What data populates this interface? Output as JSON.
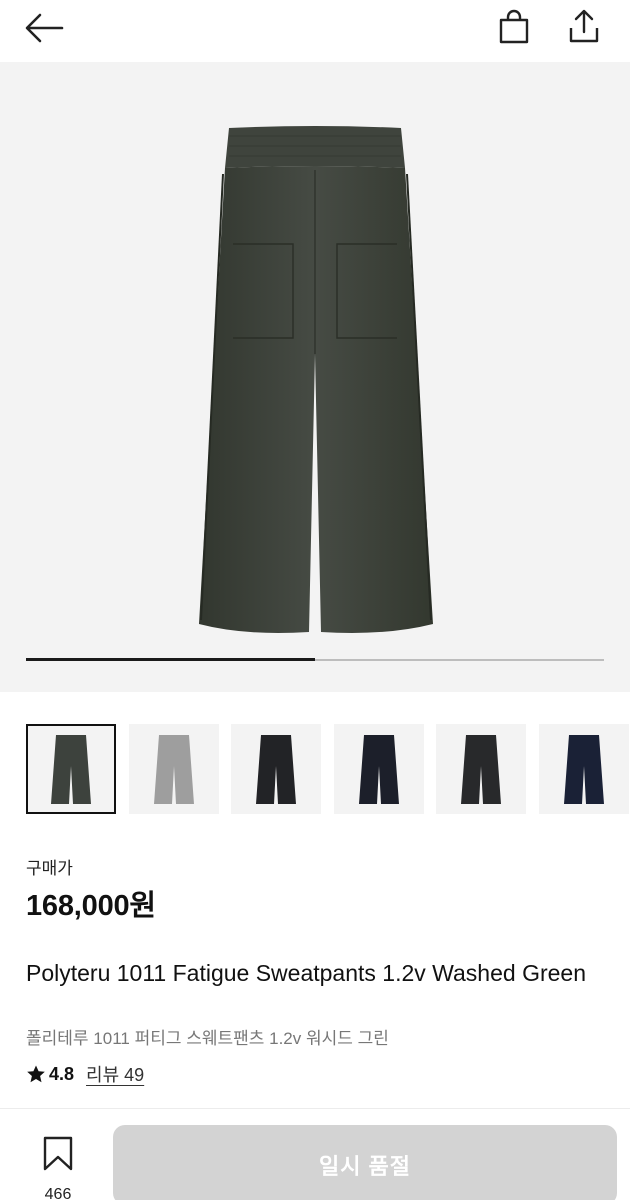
{
  "header": {
    "back_icon": "arrow-left-icon",
    "bag_icon": "shopping-bag-icon",
    "share_icon": "share-upload-icon"
  },
  "gallery": {
    "progress_fraction": 0.5,
    "thumbnails": [
      {
        "color": "#3d423d",
        "selected": true
      },
      {
        "color": "#9e9e9e",
        "selected": false
      },
      {
        "color": "#222326",
        "selected": false
      },
      {
        "color": "#1c1f2a",
        "selected": false
      },
      {
        "color": "#28292b",
        "selected": false
      },
      {
        "color": "#1a2136",
        "selected": false
      }
    ]
  },
  "product": {
    "price_label": "구매가",
    "price": "168,000원",
    "name_en": "Polyteru 1011 Fatigue Sweatpants 1.2v Washed Green",
    "name_ko": "폴리테루 1011 퍼티그 스웨트팬츠 1.2v 워시드 그린",
    "rating": "4.8",
    "reviews_label": "리뷰 49"
  },
  "footer": {
    "wish_icon": "bookmark-icon",
    "wish_count": "466",
    "soldout_label": "일시 품절"
  },
  "colors": {
    "soldout_bg": "#d3d3d3",
    "hero_bg": "#f3f3f3",
    "product_green": "#3d423d"
  }
}
